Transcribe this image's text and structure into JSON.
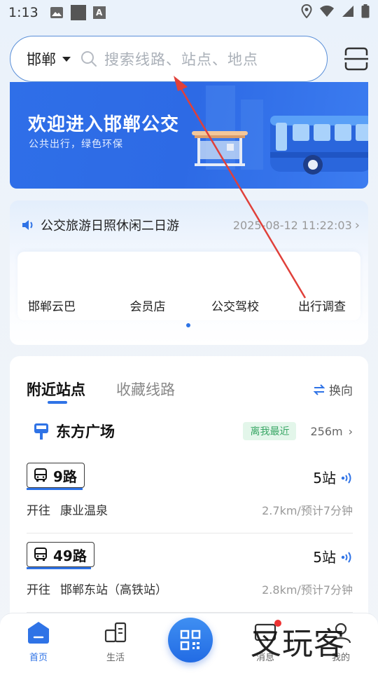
{
  "status_bar": {
    "time": "1:13",
    "icons": [
      "image-icon",
      "square-icon",
      "a-icon",
      "location-icon",
      "wifi-icon",
      "signal-icon",
      "battery-icon"
    ]
  },
  "header": {
    "city": "邯郸",
    "search_placeholder": "搜索线路、站点、地点"
  },
  "banner": {
    "title": "欢迎进入邯郸公交",
    "subtitle": "公共出行，绿色环保"
  },
  "notice": {
    "text": "公交旅游日照休闲二日游",
    "time": "2025-08-12 11:22:03",
    "chevron": "›"
  },
  "quick_links": [
    {
      "label": "邯郸云巴"
    },
    {
      "label": "会员店"
    },
    {
      "label": "公交驾校"
    },
    {
      "label": "出行调查"
    }
  ],
  "nearby": {
    "tabs": [
      {
        "label": "附近站点",
        "active": true
      },
      {
        "label": "收藏线路",
        "active": false
      }
    ],
    "swap_label": "换向",
    "stop": {
      "name": "东方广场",
      "badge": "离我最近",
      "distance": "256m",
      "chevron": "›"
    },
    "routes": [
      {
        "number": "9路",
        "stops": "5站",
        "dest_prefix": "开往",
        "dest": "康业温泉",
        "eta": "2.7km/预计7分钟"
      },
      {
        "number": "49路",
        "stops": "5站",
        "dest_prefix": "开往",
        "dest": "邯郸东站（高铁站）",
        "eta": "2.8km/预计7分钟"
      }
    ]
  },
  "bottom_nav": {
    "items": [
      {
        "label": "首页",
        "active": true
      },
      {
        "label": "生活",
        "active": false
      },
      {
        "label": "消息",
        "active": false
      },
      {
        "label": "我的",
        "active": false
      }
    ]
  },
  "watermark": "叉玩客",
  "colors": {
    "accent": "#2f73e6",
    "banner": "#2f6fe8",
    "badge_green": "#3aa766",
    "annotation_red": "#e0403a"
  }
}
